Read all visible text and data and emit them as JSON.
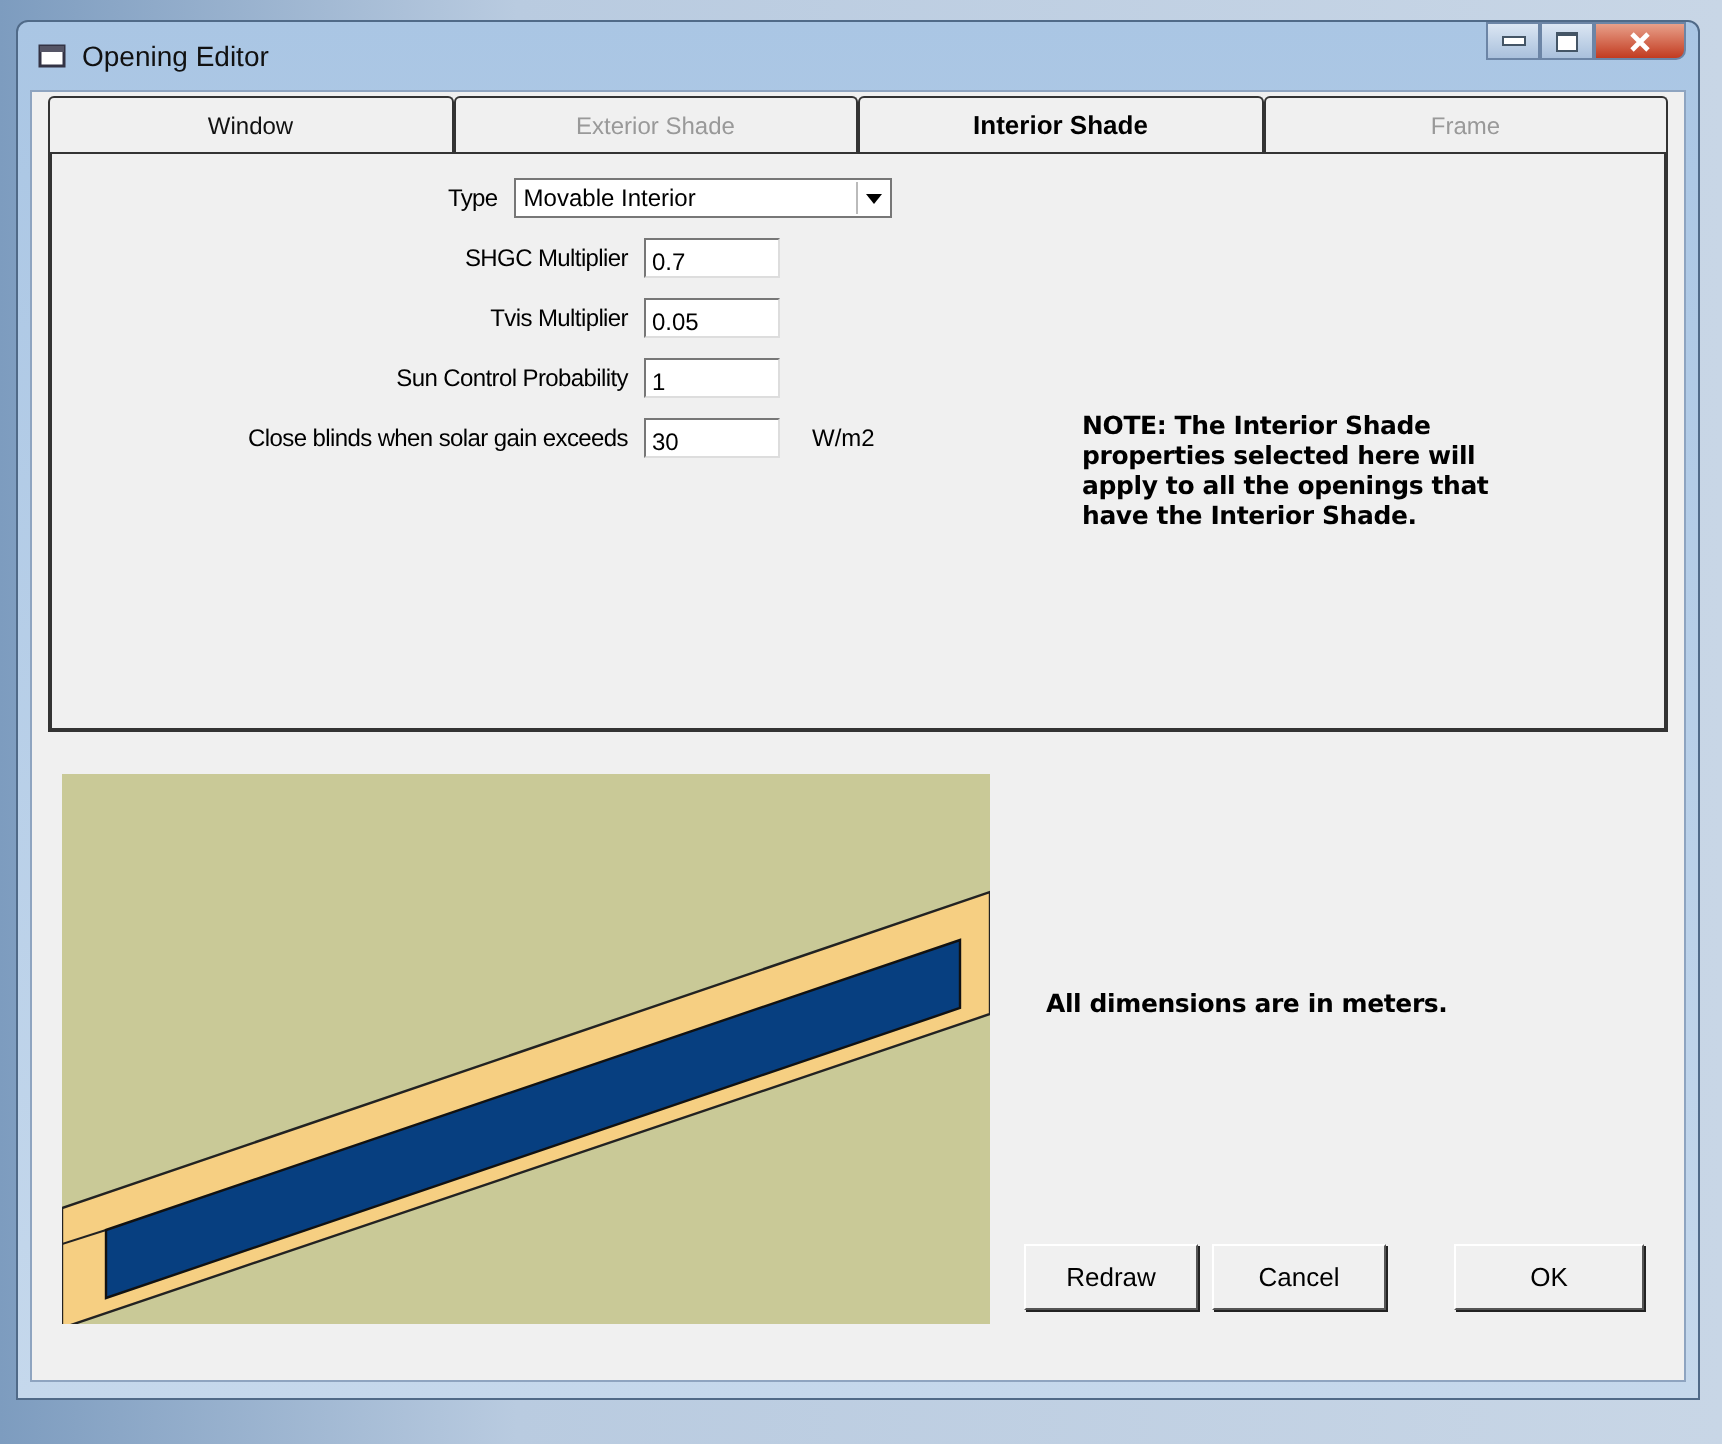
{
  "window": {
    "title": "Opening Editor"
  },
  "tabs": [
    {
      "label": "Window",
      "selected": false,
      "disabled": false
    },
    {
      "label": "Exterior Shade",
      "selected": false,
      "disabled": true
    },
    {
      "label": "Interior Shade",
      "selected": true,
      "disabled": false
    },
    {
      "label": "Frame",
      "selected": false,
      "disabled": true
    }
  ],
  "fields": [
    {
      "kind": "dropdown",
      "label": "Type",
      "value": "Movable Interior"
    },
    {
      "kind": "text",
      "label": "SHGC Multiplier",
      "value": "0.7"
    },
    {
      "kind": "text",
      "label": "Tvis Multiplier",
      "value": "0.05"
    },
    {
      "kind": "text",
      "label": "Sun Control Probability",
      "value": "1"
    },
    {
      "kind": "text",
      "label": "Close blinds when solar gain exceeds",
      "value": "30",
      "unit": "W/m2"
    }
  ],
  "note": "NOTE: The Interior Shade properties selected here will apply to all the openings that have the Interior Shade.",
  "dimensions_note": "All dimensions are in meters.",
  "buttons": [
    "Redraw",
    "Cancel",
    "OK"
  ]
}
